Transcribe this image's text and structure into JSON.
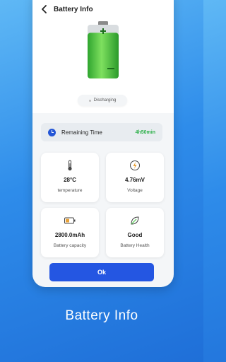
{
  "header": {
    "title": "Battery Info"
  },
  "battery": {
    "level": 0.85,
    "fill_color": "#3cc13b",
    "status": "Discharging"
  },
  "remaining": {
    "label": "Remaining Time",
    "value": "4h50min",
    "value_color": "#2fb14b"
  },
  "cards": [
    {
      "icon": "thermometer-icon",
      "value": "28°C",
      "label": "temperature"
    },
    {
      "icon": "bolt-icon",
      "value": "4.76mV",
      "label": "Voltage"
    },
    {
      "icon": "battery-icon",
      "value": "2800.0mAh",
      "label": "Battery capacity"
    },
    {
      "icon": "leaf-icon",
      "value": "Good",
      "label": "Battery Health"
    }
  ],
  "ok_button": {
    "label": "Ok"
  },
  "caption": "Battery Info",
  "colors": {
    "accent": "#2456e2",
    "background": "#2e8cea"
  }
}
